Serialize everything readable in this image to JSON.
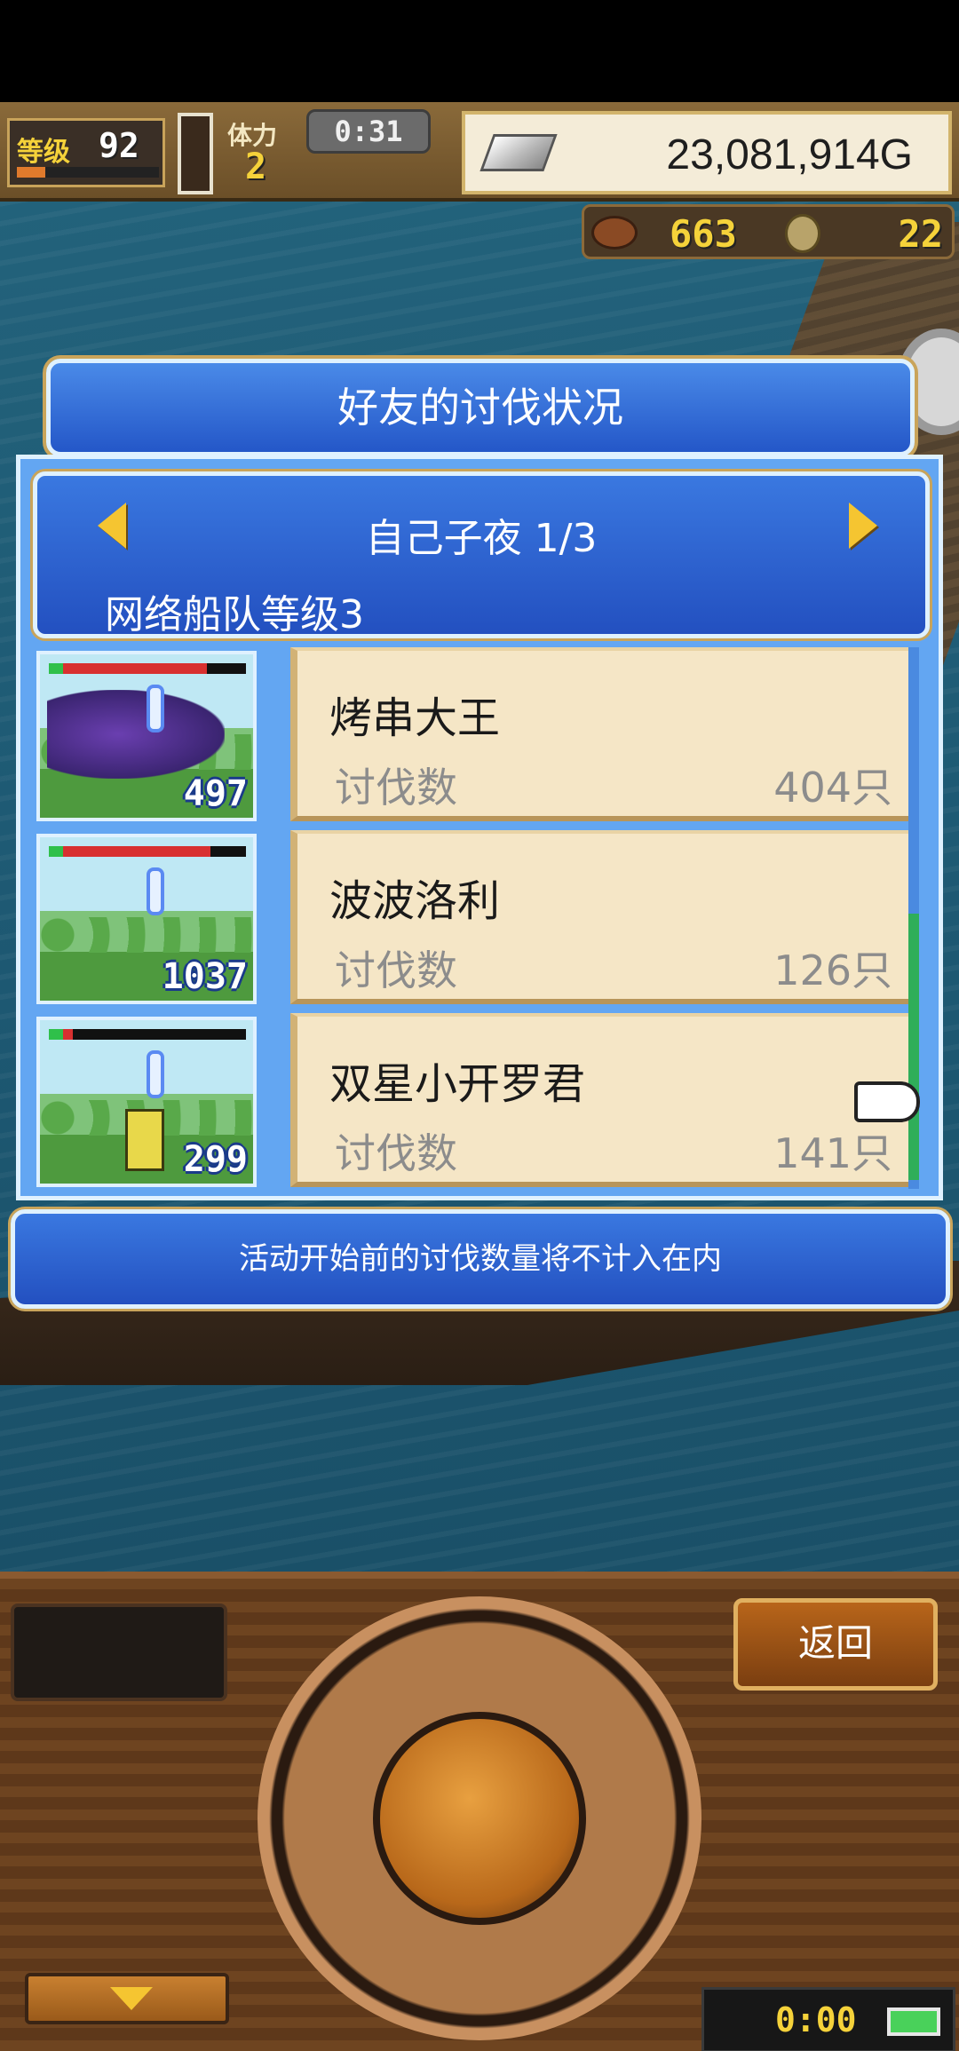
{
  "hud": {
    "level_label": "等级",
    "level_value": "92",
    "level_progress": 0.2,
    "stamina_label": "体力",
    "stamina_value": "2",
    "timer": "0:31",
    "gold": "23,081,914G",
    "food": "663",
    "coins": "22"
  },
  "dialog": {
    "title": "好友的讨伐状况",
    "day_label": "自己子夜 1/3",
    "fleet_label": "网络船队等级3",
    "kill_label": "讨伐数",
    "rows": [
      {
        "name": "烤串大王",
        "kills": "404只",
        "thumb_count": "497",
        "hp_fraction": 0.8
      },
      {
        "name": "波波洛利",
        "kills": "126只",
        "thumb_count": "1037",
        "hp_fraction": 0.82
      },
      {
        "name": "双星小开罗君",
        "kills": "141只",
        "thumb_count": "299",
        "hp_fraction": 0.12
      }
    ],
    "notice": "活动开始前的讨伐数量将不计入在内"
  },
  "controls": {
    "back_label": "返回",
    "clock": "0:00"
  },
  "icons": [
    "silver-bar-icon",
    "meat-icon",
    "coin-icon",
    "arrow-left-icon",
    "arrow-right-icon",
    "pointing-hand-icon",
    "chevron-down-icon",
    "battery-icon"
  ],
  "colors": {
    "accent_blue": "#2457c8",
    "gold_text": "#f5d23a",
    "card_bg": "#f5e6c6"
  }
}
